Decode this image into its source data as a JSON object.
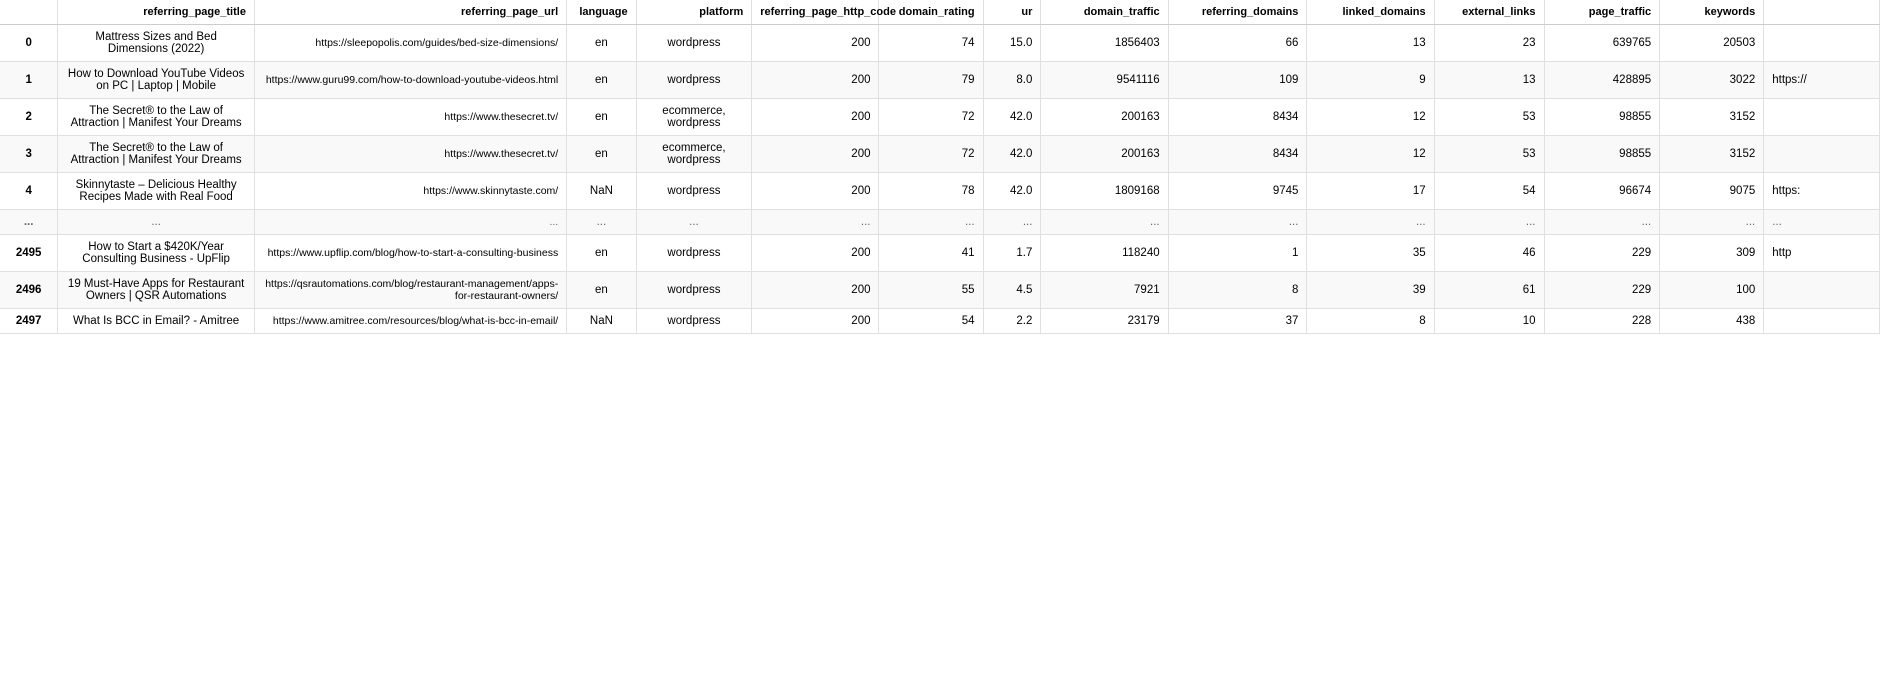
{
  "columns": [
    {
      "key": "index",
      "label": ""
    },
    {
      "key": "referring_page_title",
      "label": "referring_page_title"
    },
    {
      "key": "referring_page_url",
      "label": "referring_page_url"
    },
    {
      "key": "language",
      "label": "language"
    },
    {
      "key": "platform",
      "label": "platform"
    },
    {
      "key": "referring_page_http_code",
      "label": "referring_page_http_code"
    },
    {
      "key": "domain_rating",
      "label": "domain_rating"
    },
    {
      "key": "ur",
      "label": "ur"
    },
    {
      "key": "domain_traffic",
      "label": "domain_traffic"
    },
    {
      "key": "referring_domains",
      "label": "referring_domains"
    },
    {
      "key": "linked_domains",
      "label": "linked_domains"
    },
    {
      "key": "external_links",
      "label": "external_links"
    },
    {
      "key": "page_traffic",
      "label": "page_traffic"
    },
    {
      "key": "keywords",
      "label": "keywords"
    },
    {
      "key": "extra",
      "label": ""
    }
  ],
  "rows": [
    {
      "index": "0",
      "referring_page_title": "Mattress Sizes and Bed Dimensions (2022)",
      "referring_page_url": "https://sleepopolis.com/guides/bed-size-dimensions/",
      "language": "en",
      "platform": "wordpress",
      "referring_page_http_code": "200",
      "domain_rating": "74",
      "ur": "15.0",
      "domain_traffic": "1856403",
      "referring_domains": "66",
      "linked_domains": "13",
      "external_links": "23",
      "page_traffic": "639765",
      "keywords": "20503",
      "extra": ""
    },
    {
      "index": "1",
      "referring_page_title": "How to Download YouTube Videos on PC | Laptop | Mobile",
      "referring_page_url": "https://www.guru99.com/how-to-download-youtube-videos.html",
      "language": "en",
      "platform": "wordpress",
      "referring_page_http_code": "200",
      "domain_rating": "79",
      "ur": "8.0",
      "domain_traffic": "9541116",
      "referring_domains": "109",
      "linked_domains": "9",
      "external_links": "13",
      "page_traffic": "428895",
      "keywords": "3022",
      "extra": "https://"
    },
    {
      "index": "2",
      "referring_page_title": "The Secret® to the Law of Attraction | Manifest Your Dreams",
      "referring_page_url": "https://www.thesecret.tv/",
      "language": "en",
      "platform": "ecommerce, wordpress",
      "referring_page_http_code": "200",
      "domain_rating": "72",
      "ur": "42.0",
      "domain_traffic": "200163",
      "referring_domains": "8434",
      "linked_domains": "12",
      "external_links": "53",
      "page_traffic": "98855",
      "keywords": "3152",
      "extra": ""
    },
    {
      "index": "3",
      "referring_page_title": "The Secret® to the Law of Attraction | Manifest Your Dreams",
      "referring_page_url": "https://www.thesecret.tv/",
      "language": "en",
      "platform": "ecommerce, wordpress",
      "referring_page_http_code": "200",
      "domain_rating": "72",
      "ur": "42.0",
      "domain_traffic": "200163",
      "referring_domains": "8434",
      "linked_domains": "12",
      "external_links": "53",
      "page_traffic": "98855",
      "keywords": "3152",
      "extra": ""
    },
    {
      "index": "4",
      "referring_page_title": "Skinnytaste – Delicious Healthy Recipes Made with Real Food",
      "referring_page_url": "https://www.skinnytaste.com/",
      "language": "NaN",
      "platform": "wordpress",
      "referring_page_http_code": "200",
      "domain_rating": "78",
      "ur": "42.0",
      "domain_traffic": "1809168",
      "referring_domains": "9745",
      "linked_domains": "17",
      "external_links": "54",
      "page_traffic": "96674",
      "keywords": "9075",
      "extra": "https:"
    },
    {
      "index": "...",
      "referring_page_title": "...",
      "referring_page_url": "...",
      "language": "...",
      "platform": "...",
      "referring_page_http_code": "...",
      "domain_rating": "...",
      "ur": "...",
      "domain_traffic": "...",
      "referring_domains": "...",
      "linked_domains": "...",
      "external_links": "...",
      "page_traffic": "...",
      "keywords": "...",
      "extra": "..."
    },
    {
      "index": "2495",
      "referring_page_title": "How to Start a $420K/Year Consulting Business - UpFlip",
      "referring_page_url": "https://www.upflip.com/blog/how-to-start-a-consulting-business",
      "language": "en",
      "platform": "wordpress",
      "referring_page_http_code": "200",
      "domain_rating": "41",
      "ur": "1.7",
      "domain_traffic": "118240",
      "referring_domains": "1",
      "linked_domains": "35",
      "external_links": "46",
      "page_traffic": "229",
      "keywords": "309",
      "extra": "http"
    },
    {
      "index": "2496",
      "referring_page_title": "19 Must-Have Apps for Restaurant Owners | QSR Automations",
      "referring_page_url": "https://qsrautomations.com/blog/restaurant-management/apps-for-restaurant-owners/",
      "language": "en",
      "platform": "wordpress",
      "referring_page_http_code": "200",
      "domain_rating": "55",
      "ur": "4.5",
      "domain_traffic": "7921",
      "referring_domains": "8",
      "linked_domains": "39",
      "external_links": "61",
      "page_traffic": "229",
      "keywords": "100",
      "extra": ""
    },
    {
      "index": "2497",
      "referring_page_title": "What Is BCC in Email? - Amitree",
      "referring_page_url": "https://www.amitree.com/resources/blog/what-is-bcc-in-email/",
      "language": "NaN",
      "platform": "wordpress",
      "referring_page_http_code": "200",
      "domain_rating": "54",
      "ur": "2.2",
      "domain_traffic": "23179",
      "referring_domains": "37",
      "linked_domains": "8",
      "external_links": "10",
      "page_traffic": "228",
      "keywords": "438",
      "extra": ""
    }
  ]
}
